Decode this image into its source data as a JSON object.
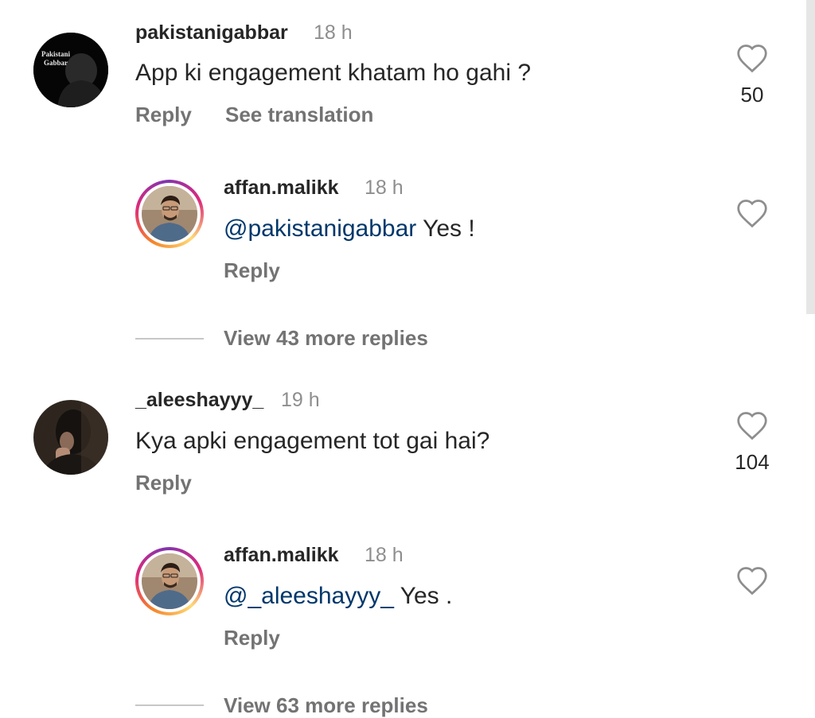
{
  "comments": [
    {
      "username": "pakistanigabbar",
      "time": "18 h",
      "text": "App ki engagement khatam ho gahi ?",
      "reply_label": "Reply",
      "translate_label": "See translation",
      "likes": "50",
      "avatar_text_line1": "Pakistani",
      "avatar_text_line2": "Gabbar",
      "reply": {
        "username": "affan.malikk",
        "time": "18 h",
        "mention": "@pakistanigabbar",
        "text": " Yes !",
        "reply_label": "Reply"
      },
      "view_replies": "View 43 more replies"
    },
    {
      "username": "_aleeshayyy_",
      "time": "19 h",
      "text": "Kya apki engagement tot gai hai?",
      "reply_label": "Reply",
      "likes": "104",
      "reply": {
        "username": "affan.malikk",
        "time": "18 h",
        "mention": "@_aleeshayyy_",
        "text": " Yes .",
        "reply_label": "Reply"
      },
      "view_replies": "View 63 more replies"
    }
  ],
  "colors": {
    "mention": "#00376b",
    "secondary_text": "#737373",
    "story_ring": "#dd2a7b"
  },
  "icons": {
    "like": "heart-outline-icon"
  }
}
